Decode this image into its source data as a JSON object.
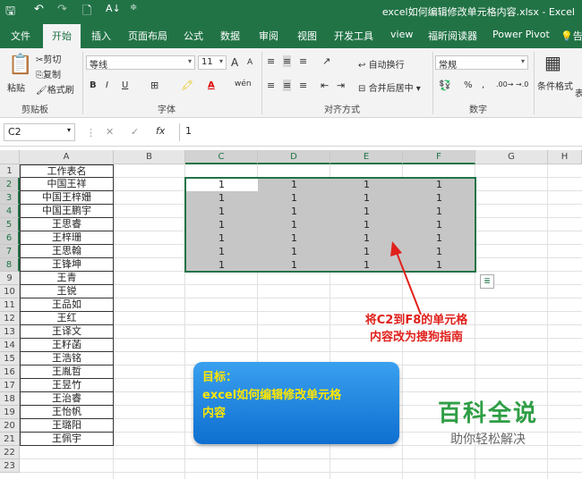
{
  "window": {
    "title": "excel如何编辑修改单元格内容.xlsx  -  Excel",
    "qa_icons": [
      "save-icon",
      "undo-icon",
      "redo-icon",
      "print-preview-icon",
      "sort-icon",
      "customize-icon"
    ]
  },
  "tabs": [
    {
      "label": "文件"
    },
    {
      "label": "开始"
    },
    {
      "label": "插入"
    },
    {
      "label": "页面布局"
    },
    {
      "label": "公式"
    },
    {
      "label": "数据"
    },
    {
      "label": "审阅"
    },
    {
      "label": "视图"
    },
    {
      "label": "开发工具"
    },
    {
      "label": "view"
    },
    {
      "label": "福昕阅读器"
    },
    {
      "label": "Power Pivot"
    },
    {
      "label": "告"
    }
  ],
  "ribbon": {
    "clipboard": {
      "paste": "粘贴",
      "cut": "剪切",
      "copy": "复制",
      "format_painter": "格式刷",
      "group": "剪贴板"
    },
    "font": {
      "font_name": "等线",
      "font_size": "11",
      "grow": "A",
      "shrink": "A",
      "bold": "B",
      "italic": "I",
      "underline": "U",
      "font_color": "A",
      "group": "字体"
    },
    "alignment": {
      "wrap": "自动换行",
      "merge": "合并后居中",
      "group": "对齐方式"
    },
    "number": {
      "format": "常规",
      "percent": "%",
      "comma": ",",
      "group": "数字"
    },
    "styles": {
      "conditional": "条件格式",
      "table": "表"
    }
  },
  "formula_bar": {
    "name_box": "C2",
    "formula": "1",
    "fx": "fx"
  },
  "columns": [
    "A",
    "B",
    "C",
    "D",
    "E",
    "F",
    "G",
    "H"
  ],
  "rows": [
    "1",
    "2",
    "3",
    "4",
    "5",
    "6",
    "7",
    "8",
    "9",
    "10",
    "11",
    "12",
    "13",
    "14",
    "15",
    "16",
    "17",
    "18",
    "19",
    "20",
    "21",
    "22",
    "23"
  ],
  "column_a": [
    "工作表名",
    "中国王祥",
    "中国王梓姗",
    "中国王鹏宇",
    "王思睿",
    "王梓珊",
    "王思翰",
    "王锋坤",
    "王青",
    "王锐",
    "王品如",
    "王红",
    "王译文",
    "王籽菡",
    "王浩铭",
    "王胤哲",
    "王昱竹",
    "王治睿",
    "王怡帆",
    "王璐阳",
    "王佩宇"
  ],
  "selection_values": [
    [
      "1",
      "1",
      "1",
      "1"
    ],
    [
      "1",
      "1",
      "1",
      "1"
    ],
    [
      "1",
      "1",
      "1",
      "1"
    ],
    [
      "1",
      "1",
      "1",
      "1"
    ],
    [
      "1",
      "1",
      "1",
      "1"
    ],
    [
      "1",
      "1",
      "1",
      "1"
    ],
    [
      "1",
      "1",
      "1",
      "1"
    ]
  ],
  "annotation": {
    "line1": "将C2到F8的单元格",
    "line2": "内容改为搜狗指南"
  },
  "goal": {
    "line1": "目标：",
    "line2": "excel如何编辑修改单元格",
    "line3": "内容"
  },
  "watermark": {
    "title": "百科全说",
    "subtitle": "助你轻松解决"
  },
  "colors": {
    "excel_green": "#217346",
    "annotation_red": "#e0201b",
    "goal_text": "#ffe600",
    "watermark_green": "#2f9e45"
  }
}
